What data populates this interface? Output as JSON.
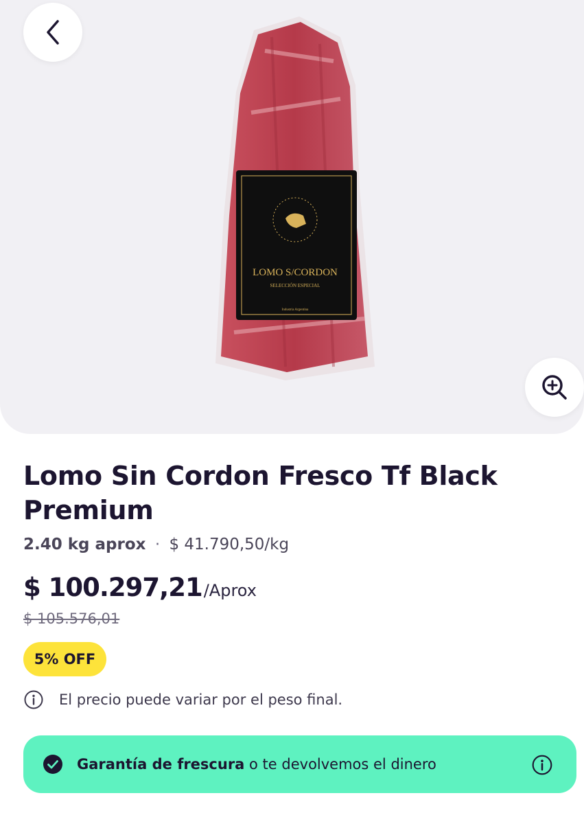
{
  "nav": {
    "back_icon": "chevron-left-icon",
    "zoom_icon": "zoom-in-icon"
  },
  "product": {
    "title": "Lomo Sin Cordon Fresco Tf Black Premium",
    "weight": "2.40 kg aprox",
    "separator": "·",
    "price_per_kg": "$ 41.790,50/kg",
    "price": "$ 100.297,21",
    "price_unit": "/Aprox",
    "old_price": "$ 105.576,01",
    "discount_badge": "5% OFF",
    "image_label": {
      "ring_text": "TF CARNES TF CARNES",
      "name": "LOMO S/CORDON",
      "subtitle": "SELECCIÓN ESPECIAL",
      "origin": "Industria Argentina"
    }
  },
  "notice": {
    "icon": "info-icon",
    "text": "El precio puede variar por el peso final."
  },
  "guarantee": {
    "icon": "check-circle-icon",
    "bold": "Garantía de frescura",
    "rest": " o te devolvemos el dinero",
    "info_icon": "info-icon"
  },
  "colors": {
    "accent_green": "#5ef2c0",
    "badge_yellow": "#fde33a",
    "text_dark": "#1c1530"
  }
}
